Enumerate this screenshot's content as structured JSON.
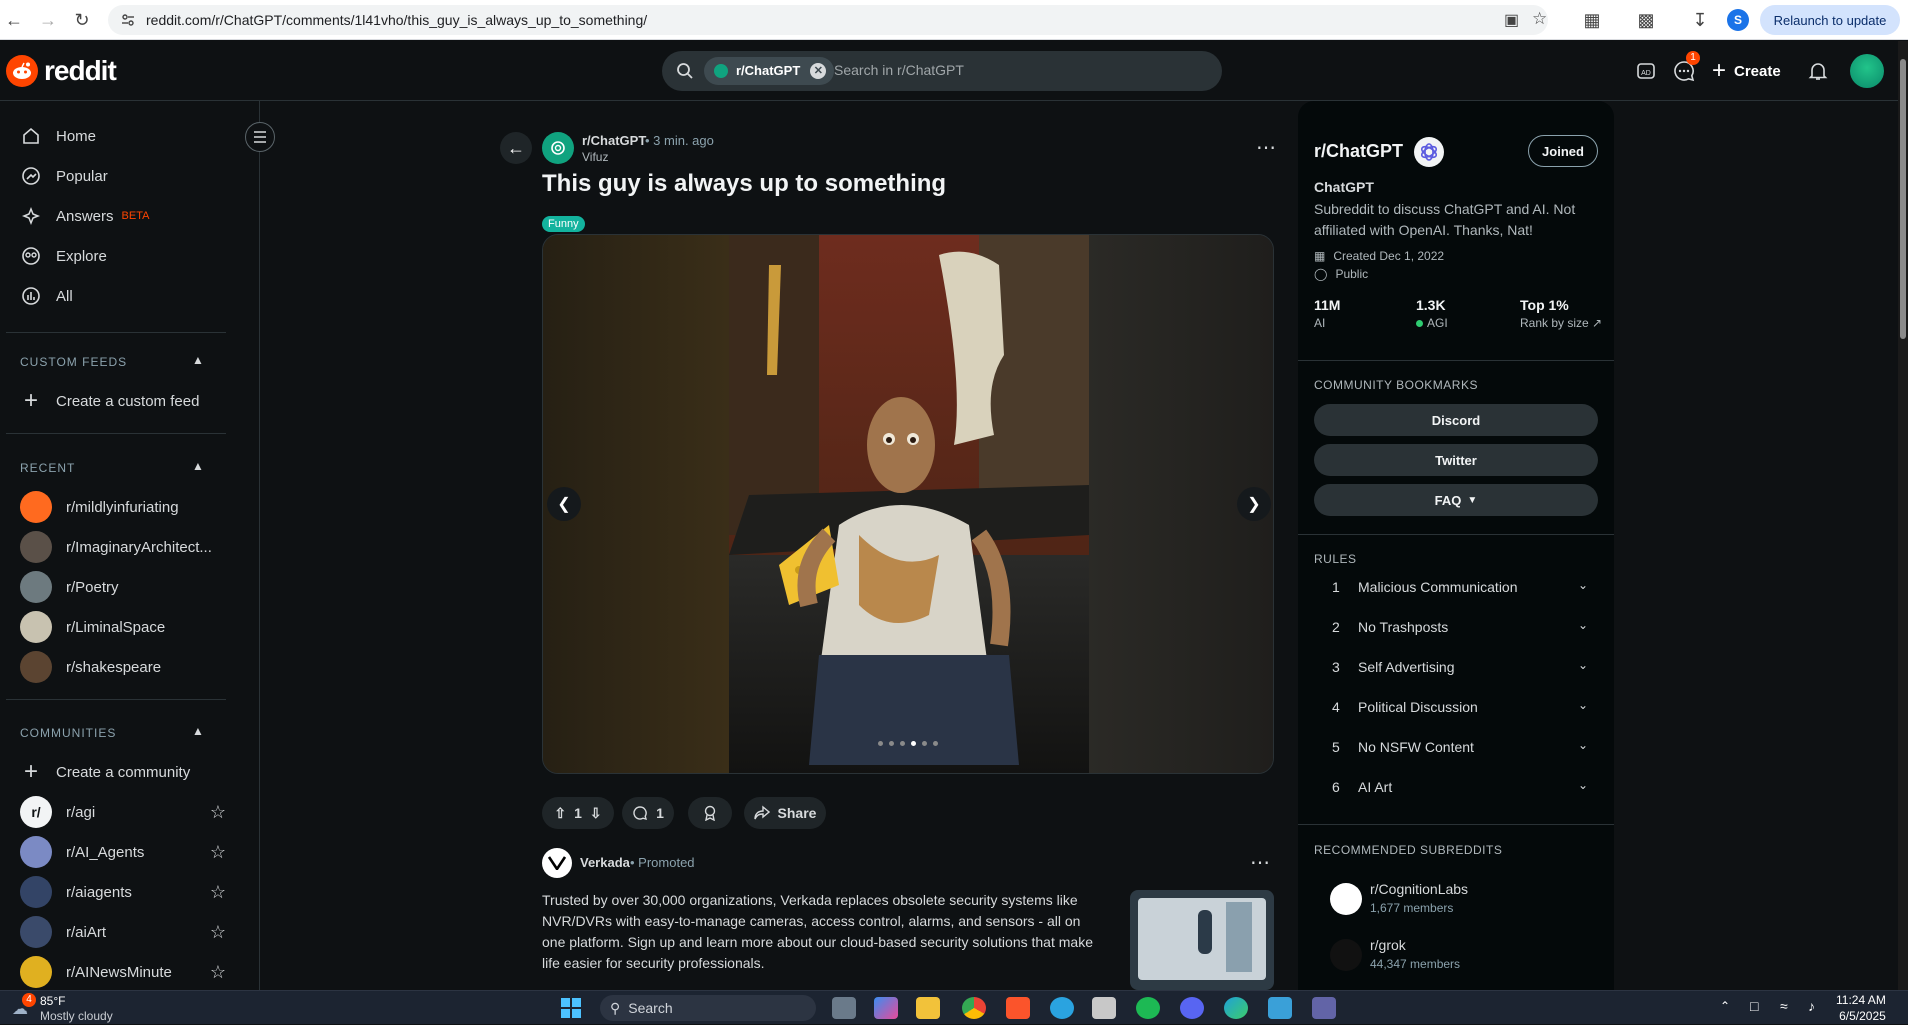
{
  "browser": {
    "url": "reddit.com/r/ChatGPT/comments/1l41vho/this_guy_is_always_up_to_something/",
    "relaunch_label": "Relaunch to update",
    "profile_initial": "S"
  },
  "header": {
    "logo_text": "reddit",
    "search_chip": "r/ChatGPT",
    "search_placeholder": "Search in r/ChatGPT",
    "create_label": "Create",
    "chat_badge": "1"
  },
  "sidebar": {
    "main_items": [
      {
        "label": "Home",
        "icon": "home-icon"
      },
      {
        "label": "Popular",
        "icon": "popular-icon"
      },
      {
        "label": "Answers",
        "icon": "answers-icon",
        "tag": "BETA"
      },
      {
        "label": "Explore",
        "icon": "explore-icon"
      },
      {
        "label": "All",
        "icon": "all-icon"
      }
    ],
    "custom_feeds_title": "CUSTOM FEEDS",
    "create_custom_feed": "Create a custom feed",
    "recent_title": "RECENT",
    "recent": [
      {
        "label": "r/mildlyinfuriating",
        "color": "#ff6a1f"
      },
      {
        "label": "r/ImaginaryArchitect...",
        "color": "#5a5048"
      },
      {
        "label": "r/Poetry",
        "color": "#6d7a7f"
      },
      {
        "label": "r/LiminalSpace",
        "color": "#c8c2b0"
      },
      {
        "label": "r/shakespeare",
        "color": "#5b4431"
      }
    ],
    "communities_title": "COMMUNITIES",
    "create_community": "Create a community",
    "communities": [
      {
        "label": "r/agi",
        "color": "#f2f4f5",
        "glyph": "r/"
      },
      {
        "label": "r/AI_Agents",
        "color": "#7b8ac4",
        "glyph": ""
      },
      {
        "label": "r/aiagents",
        "color": "#334466",
        "glyph": ""
      },
      {
        "label": "r/aiArt",
        "color": "#3a4a6a",
        "glyph": ""
      },
      {
        "label": "r/AINewsMinute",
        "color": "#e0b020",
        "glyph": ""
      }
    ]
  },
  "post": {
    "subreddit": "r/ChatGPT",
    "time": "• 3 min. ago",
    "author": "Vifuz",
    "title": "This guy is always up to something",
    "flair": "Funny",
    "gallery_pages": 6,
    "gallery_current": 4,
    "votes": "1",
    "comments": "1",
    "share_label": "Share"
  },
  "ad": {
    "advertiser": "Verkada",
    "promoted": "• Promoted",
    "text": "Trusted by over 30,000 organizations, Verkada replaces obsolete security systems like NVR/DVRs with easy-to-manage cameras, access control, alarms, and sensors - all on one platform. Sign up and learn more about our cloud-based security solutions that make life easier for security professionals."
  },
  "community": {
    "name": "r/ChatGPT",
    "joined_label": "Joined",
    "title": "ChatGPT",
    "description": "Subreddit to discuss ChatGPT and AI. Not affiliated with OpenAI. Thanks, Nat!",
    "created": "Created Dec 1, 2022",
    "visibility": "Public",
    "stats": [
      {
        "value": "11M",
        "label": "AI"
      },
      {
        "value": "1.3K",
        "label": "AGI"
      },
      {
        "value": "Top 1%",
        "label": "Rank by size"
      }
    ],
    "bookmarks_title": "COMMUNITY BOOKMARKS",
    "bookmarks": [
      "Discord",
      "Twitter",
      "FAQ"
    ],
    "rules_title": "RULES",
    "rules": [
      {
        "n": "1",
        "label": "Malicious Communication"
      },
      {
        "n": "2",
        "label": "No Trashposts"
      },
      {
        "n": "3",
        "label": "Self Advertising"
      },
      {
        "n": "4",
        "label": "Political Discussion"
      },
      {
        "n": "5",
        "label": "No NSFW Content"
      },
      {
        "n": "6",
        "label": "AI Art"
      }
    ],
    "recommended_title": "RECOMMENDED SUBREDDITS",
    "recommended": [
      {
        "name": "r/CognitionLabs",
        "members": "1,677 members",
        "color": "#ffffff"
      },
      {
        "name": "r/grok",
        "members": "44,347 members",
        "color": "#111111"
      }
    ]
  },
  "taskbar": {
    "temperature": "85°F",
    "weather": "Mostly cloudy",
    "weather_badge": "4",
    "search_label": "Search",
    "time": "11:24 AM",
    "date": "6/5/2025"
  }
}
